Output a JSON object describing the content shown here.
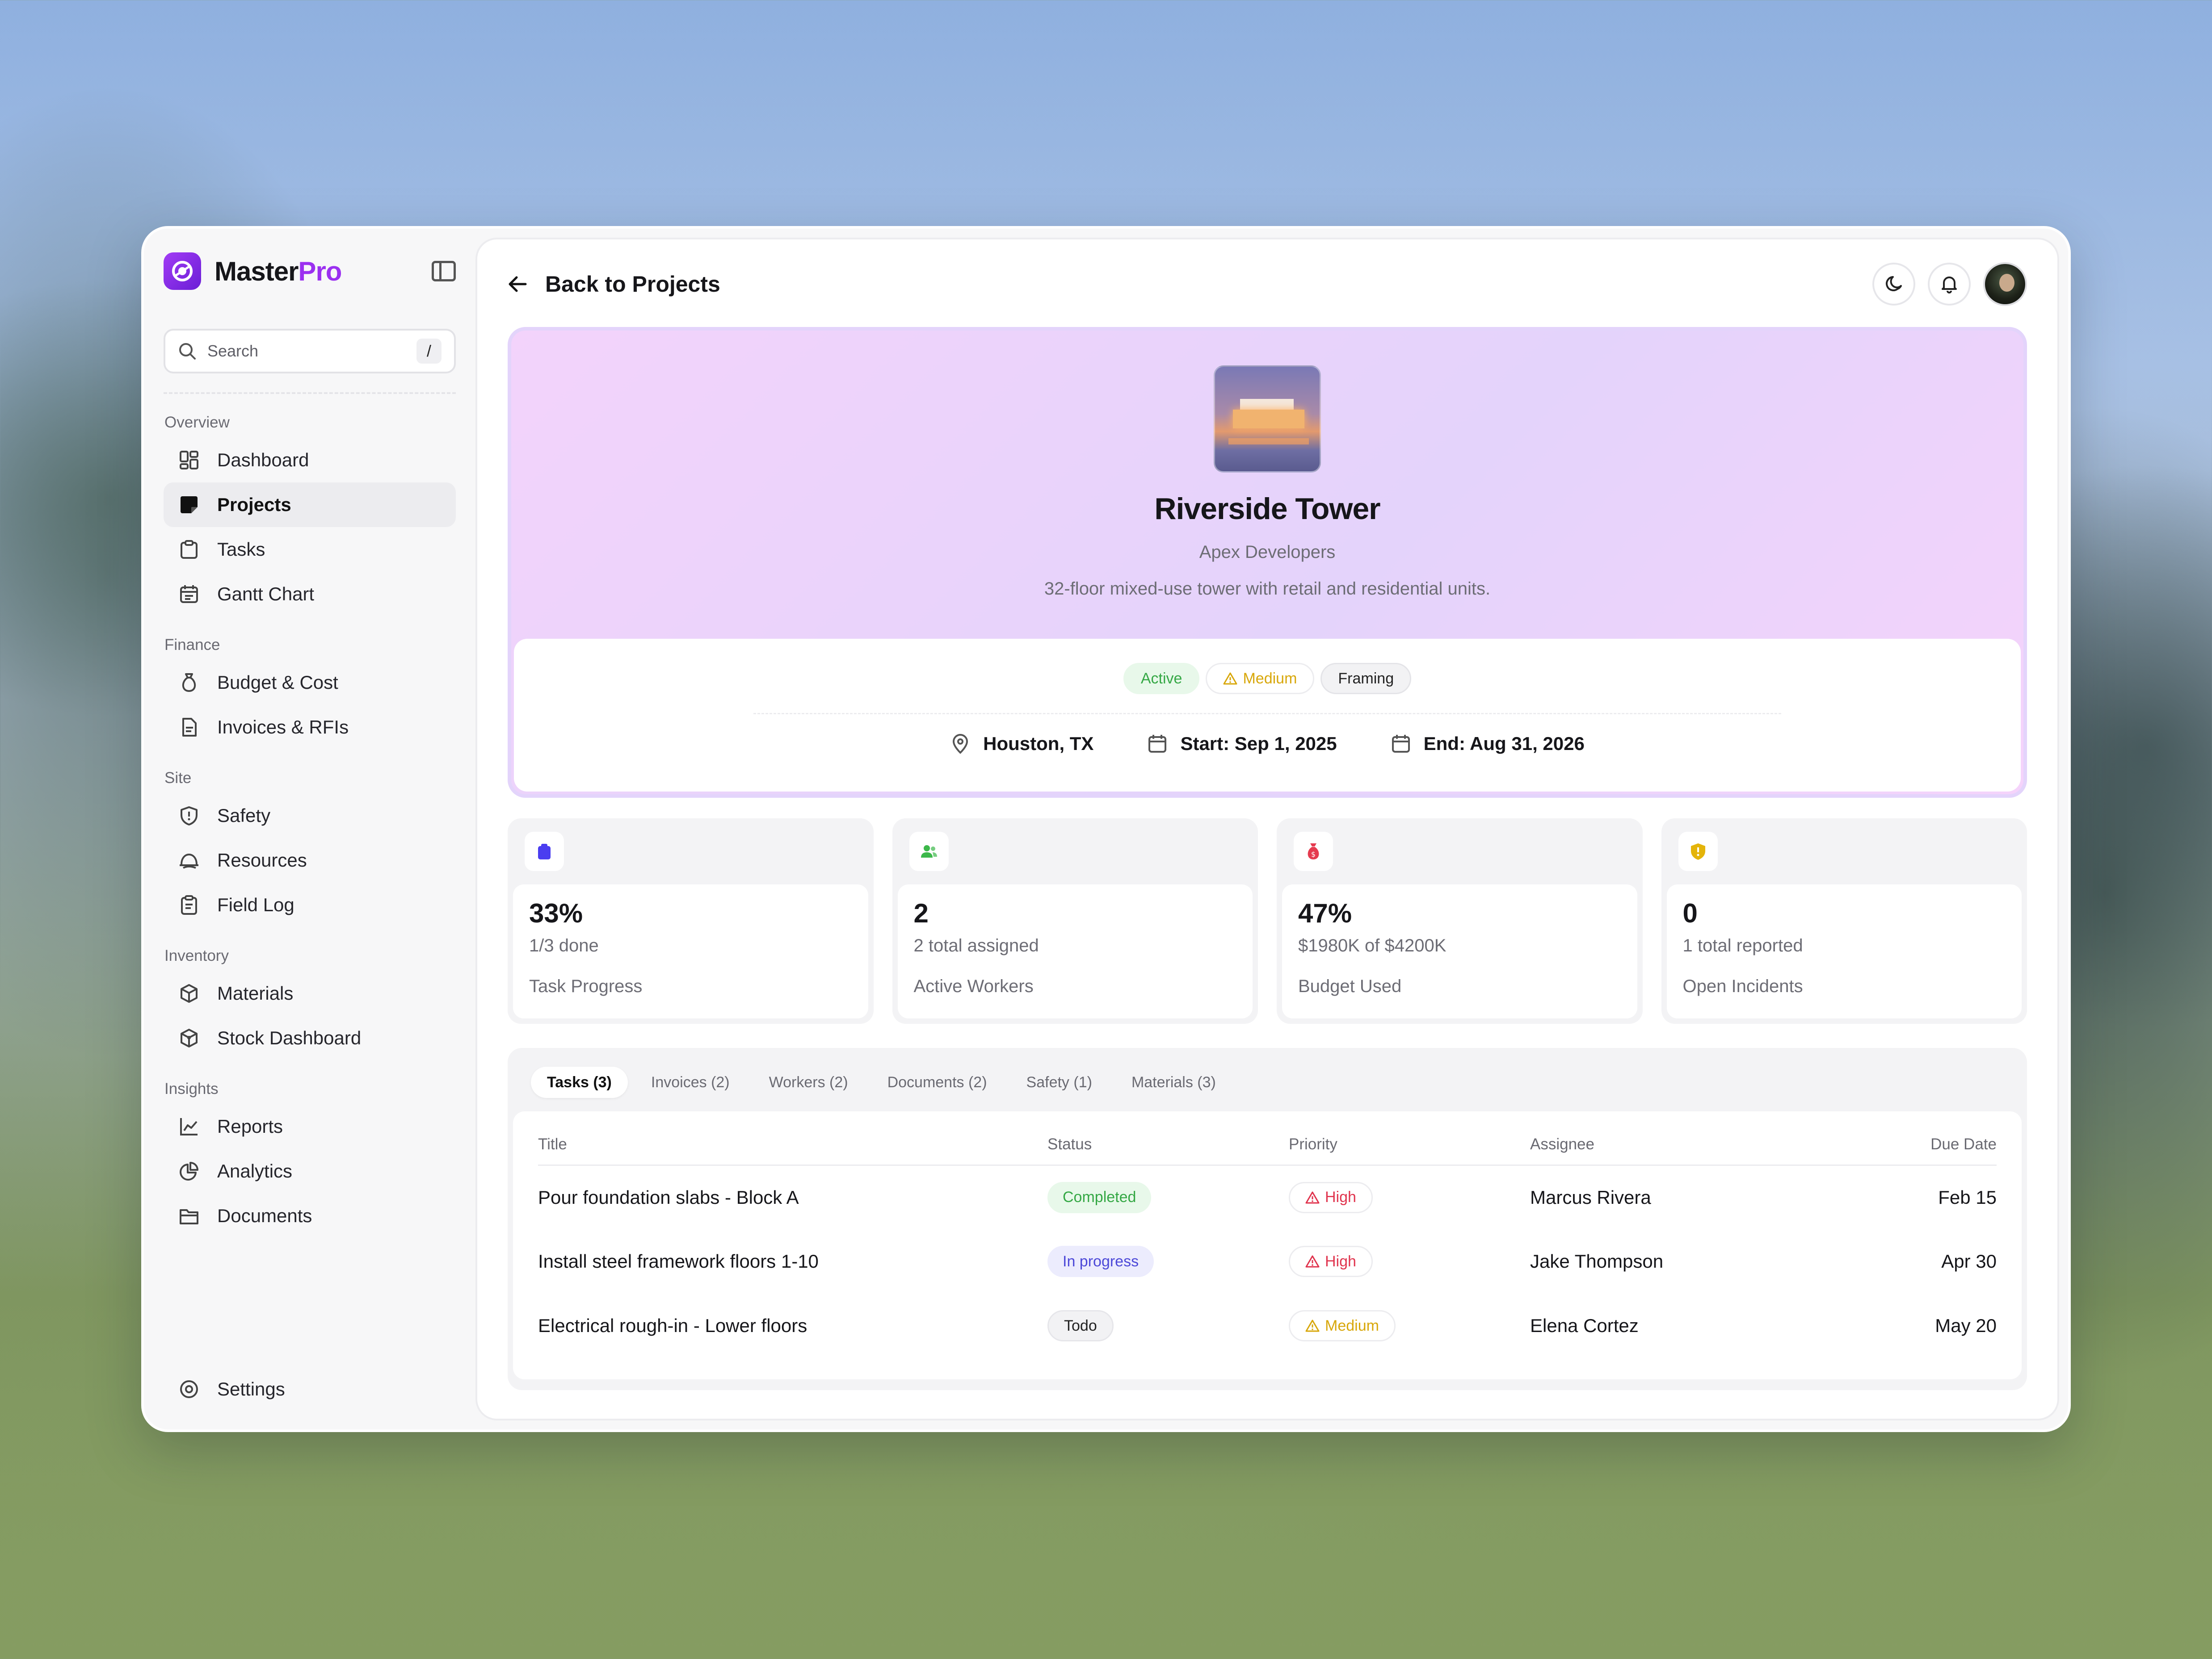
{
  "brand": {
    "name": "Master",
    "name_accent": "Pro",
    "accent_color": "#9b30f0"
  },
  "search": {
    "placeholder": "Search",
    "shortcut": "/"
  },
  "sidebar": {
    "sections": [
      {
        "label": "Overview",
        "items": [
          {
            "label": "Dashboard",
            "icon": "dashboard-icon"
          },
          {
            "label": "Projects",
            "icon": "projects-icon",
            "active": true
          },
          {
            "label": "Tasks",
            "icon": "tasks-icon"
          },
          {
            "label": "Gantt Chart",
            "icon": "calendar-icon"
          }
        ]
      },
      {
        "label": "Finance",
        "items": [
          {
            "label": "Budget & Cost",
            "icon": "money-bag-icon"
          },
          {
            "label": "Invoices & RFIs",
            "icon": "document-icon"
          }
        ]
      },
      {
        "label": "Site",
        "items": [
          {
            "label": "Safety",
            "icon": "shield-icon"
          },
          {
            "label": "Resources",
            "icon": "hard-hat-icon"
          },
          {
            "label": "Field Log",
            "icon": "clipboard-icon"
          }
        ]
      },
      {
        "label": "Inventory",
        "items": [
          {
            "label": "Materials",
            "icon": "cube-icon"
          },
          {
            "label": "Stock Dashboard",
            "icon": "stock-icon"
          }
        ]
      },
      {
        "label": "Insights",
        "items": [
          {
            "label": "Reports",
            "icon": "chart-line-icon"
          },
          {
            "label": "Analytics",
            "icon": "pie-chart-icon"
          },
          {
            "label": "Documents",
            "icon": "folder-icon"
          }
        ]
      }
    ],
    "settings_label": "Settings"
  },
  "topbar": {
    "back_label": "Back to Projects"
  },
  "project": {
    "name": "Riverside Tower",
    "client": "Apex Developers",
    "description": "32-floor mixed-use tower with retail and residential units.",
    "status": "Active",
    "priority": "Medium",
    "phase": "Framing",
    "location": "Houston, TX",
    "start": "Start: Sep 1, 2025",
    "end": "End: Aug 31, 2026"
  },
  "stats": [
    {
      "value": "33%",
      "sub": "1/3 done",
      "label": "Task Progress",
      "icon": "clipboard-icon",
      "color": "#4a3df0"
    },
    {
      "value": "2",
      "sub": "2 total assigned",
      "label": "Active Workers",
      "icon": "users-icon",
      "color": "#3cb84a"
    },
    {
      "value": "47%",
      "sub": "$1980K of $4200K",
      "label": "Budget Used",
      "icon": "money-bag-icon",
      "color": "#e53b4f"
    },
    {
      "value": "0",
      "sub": "1 total reported",
      "label": "Open Incidents",
      "icon": "shield-alert-icon",
      "color": "#e4b40a"
    }
  ],
  "tabs": [
    {
      "label": "Tasks (3)",
      "active": true
    },
    {
      "label": "Invoices (2)"
    },
    {
      "label": "Workers (2)"
    },
    {
      "label": "Documents (2)"
    },
    {
      "label": "Safety (1)"
    },
    {
      "label": "Materials (3)"
    }
  ],
  "table": {
    "columns": [
      "Title",
      "Status",
      "Priority",
      "Assignee",
      "Due Date"
    ],
    "rows": [
      {
        "title": "Pour foundation slabs - Block A",
        "status": "Completed",
        "priority": "High",
        "assignee": "Marcus Rivera",
        "due": "Feb 15"
      },
      {
        "title": "Install steel framework floors 1-10",
        "status": "In progress",
        "priority": "High",
        "assignee": "Jake Thompson",
        "due": "Apr 30"
      },
      {
        "title": "Electrical rough-in - Lower floors",
        "status": "Todo",
        "priority": "Medium",
        "assignee": "Elena Cortez",
        "due": "May 20"
      }
    ]
  }
}
